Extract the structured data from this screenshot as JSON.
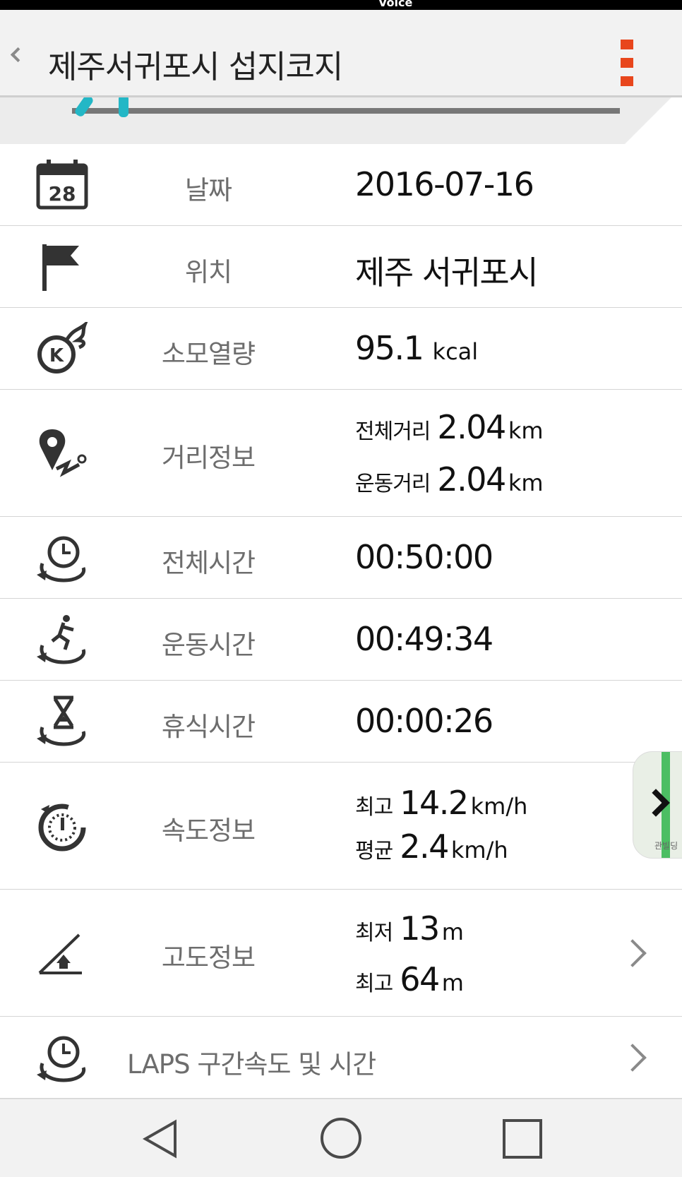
{
  "status": {
    "voice_text": "Voice"
  },
  "header": {
    "title": "제주서귀포시 섭지코지"
  },
  "rows": [
    {
      "icon": "calendar-icon",
      "calendar_day": "28",
      "label": "날짜",
      "value": "2016-07-16"
    },
    {
      "icon": "flag-icon",
      "label": "위치",
      "value": "제주 서귀포시"
    },
    {
      "icon": "calorie-icon",
      "label": "소모열량",
      "value": "95.1",
      "unit": "kcal"
    },
    {
      "icon": "distance-icon",
      "label": "거리정보",
      "lines": [
        {
          "prefix": "전체거리",
          "value": "2.04",
          "unit": "km"
        },
        {
          "prefix": "운동거리",
          "value": "2.04",
          "unit": "km"
        }
      ]
    },
    {
      "icon": "total-time-icon",
      "label": "전체시간",
      "value": "00:50:00"
    },
    {
      "icon": "exercise-time-icon",
      "label": "운동시간",
      "value": "00:49:34"
    },
    {
      "icon": "rest-time-icon",
      "label": "휴식시간",
      "value": "00:00:26"
    },
    {
      "icon": "speed-icon",
      "label": "속도정보",
      "lines": [
        {
          "prefix": "최고",
          "value": "14.2",
          "unit": "km/h"
        },
        {
          "prefix": "평균",
          "value": "2.4",
          "unit": "km/h"
        }
      ]
    },
    {
      "icon": "altitude-icon",
      "label": "고도정보",
      "lines": [
        {
          "prefix": "최저",
          "value": "13",
          "unit": "m"
        },
        {
          "prefix": "최고",
          "value": "64",
          "unit": "m"
        }
      ]
    }
  ],
  "laps": {
    "icon": "laps-icon",
    "label": "LAPS 구간속도 및 시간"
  },
  "map_thumb": {
    "label": "관빌딩"
  },
  "nav": {
    "back": "back-icon",
    "home": "home-icon",
    "recent": "recent-apps-icon"
  }
}
